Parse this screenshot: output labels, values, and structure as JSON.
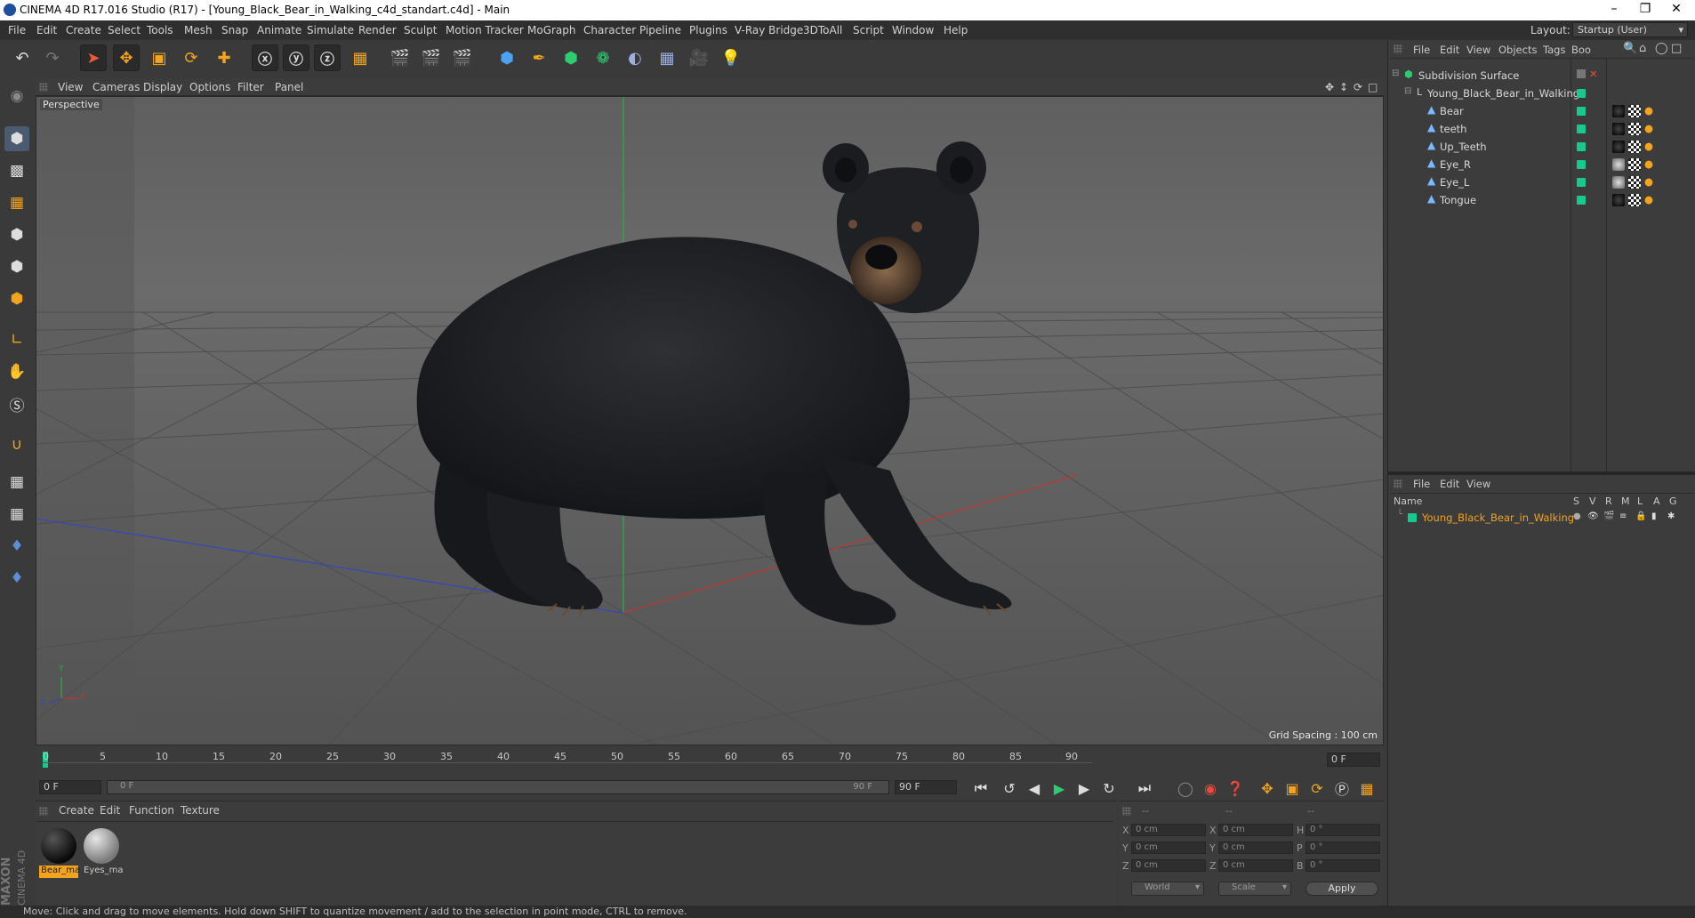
{
  "titlebar": {
    "title": "CINEMA 4D R17.016 Studio (R17) - [Young_Black_Bear_in_Walking_c4d_standart.c4d] - Main"
  },
  "menubar": {
    "items": [
      "File",
      "Edit",
      "Create",
      "Select",
      "Tools",
      "Mesh",
      "Snap",
      "Animate",
      "Simulate",
      "Render",
      "Sculpt",
      "Motion Tracker",
      "MoGraph",
      "Character",
      "Pipeline",
      "Plugins",
      "V-Ray Bridge",
      "3DToAll",
      "Script",
      "Window",
      "Help"
    ],
    "layout_label": "Layout:",
    "layout_value": "Startup (User)"
  },
  "viewport": {
    "menu": [
      "View",
      "Cameras",
      "Display",
      "Options",
      "Filter",
      "Panel"
    ],
    "label": "Perspective",
    "grid_spacing": "Grid Spacing : 100 cm",
    "axis_y": "Y",
    "axis_x": "X",
    "axis_z": "Z"
  },
  "timeline": {
    "ticks": [
      "0",
      "5",
      "10",
      "15",
      "20",
      "25",
      "30",
      "35",
      "40",
      "45",
      "50",
      "55",
      "60",
      "65",
      "70",
      "75",
      "80",
      "85",
      "90"
    ],
    "current_frame": "0 F"
  },
  "playbar": {
    "start": "0 F",
    "range_start": "0 F",
    "range_end": "90 F",
    "end": "90 F"
  },
  "materials": {
    "menu": [
      "Create",
      "Edit",
      "Function",
      "Texture"
    ],
    "items": [
      {
        "name": "Bear_ma",
        "selected": true
      },
      {
        "name": "Eyes_ma",
        "selected": false
      }
    ]
  },
  "coords": {
    "headers": [
      "--",
      "--",
      "--"
    ],
    "rows": [
      {
        "a": "X",
        "av": "0 cm",
        "b": "X",
        "bv": "0 cm",
        "c": "H",
        "cv": "0 °"
      },
      {
        "a": "Y",
        "av": "0 cm",
        "b": "Y",
        "bv": "0 cm",
        "c": "P",
        "cv": "0 °"
      },
      {
        "a": "Z",
        "av": "0 cm",
        "b": "Z",
        "bv": "0 cm",
        "c": "B",
        "cv": "0 °"
      }
    ],
    "space": "World",
    "mode": "Scale",
    "apply": "Apply"
  },
  "object_manager": {
    "menu": [
      "File",
      "Edit",
      "View",
      "Objects",
      "Tags",
      "Boo"
    ],
    "objects": [
      {
        "name": "Subdivision Surface",
        "indent": 0
      },
      {
        "name": "Young_Black_Bear_in_Walking",
        "indent": 1
      },
      {
        "name": "Bear",
        "indent": 2
      },
      {
        "name": "teeth",
        "indent": 2
      },
      {
        "name": "Up_Teeth",
        "indent": 2
      },
      {
        "name": "Eye_R",
        "indent": 2
      },
      {
        "name": "Eye_L",
        "indent": 2
      },
      {
        "name": "Tongue",
        "indent": 2
      }
    ]
  },
  "layer_manager": {
    "menu": [
      "File",
      "Edit",
      "View"
    ],
    "columns": [
      "Name",
      "S",
      "V",
      "R",
      "M",
      "L",
      "A",
      "G"
    ],
    "layer": "Young_Black_Bear_in_Walking"
  },
  "statusbar": {
    "text": "Move: Click and drag to move elements. Hold down SHIFT to quantize movement / add to the selection in point mode, CTRL to remove."
  },
  "brand": {
    "line1": "MAXON",
    "line2": "CINEMA 4D"
  },
  "colors": {
    "accent_orange": "#f2a41c",
    "selection_green": "#16c98d",
    "axis_red": "#c0392b",
    "axis_green": "#27ae60",
    "axis_blue": "#2b3fb8"
  }
}
